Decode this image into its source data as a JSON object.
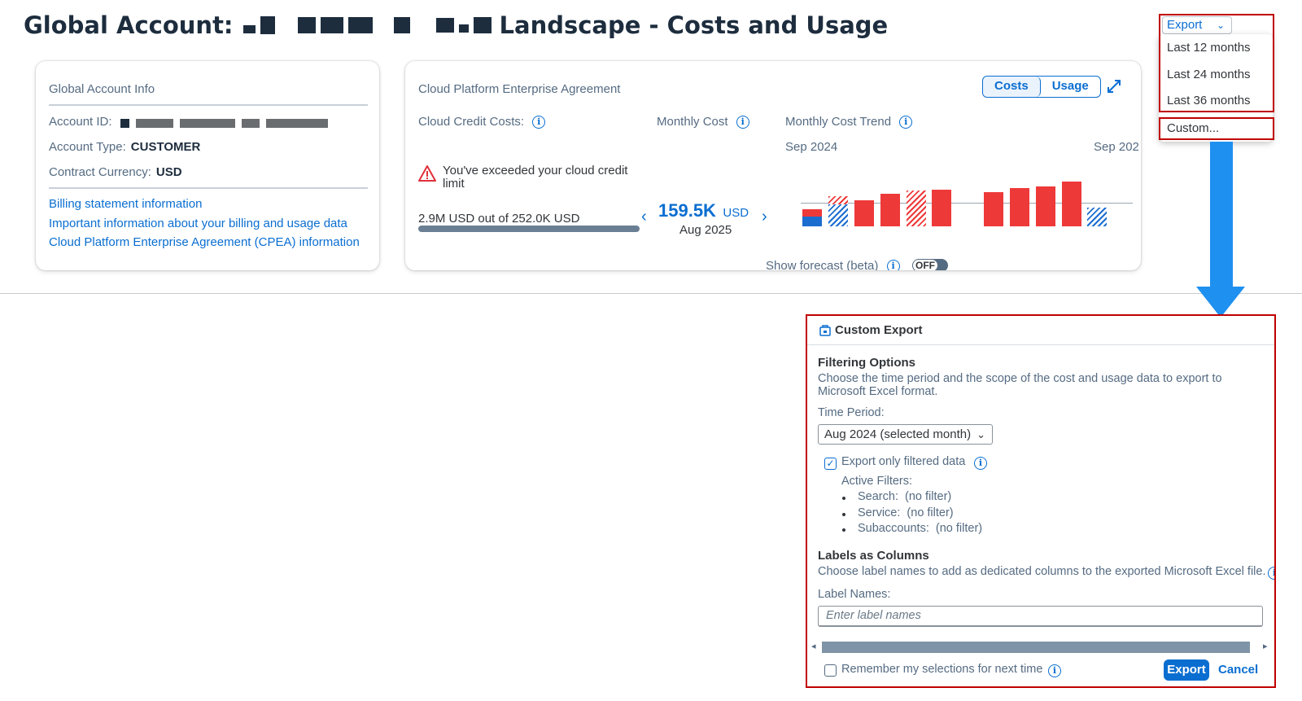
{
  "page": {
    "title_prefix": "Global Account:",
    "title_suffix": "Landscape - Costs and Usage"
  },
  "account_info": {
    "title": "Global Account Info",
    "account_id_label": "Account ID:",
    "account_type_label": "Account Type:",
    "account_type_value": "CUSTOMER",
    "currency_label": "Contract Currency:",
    "currency_value": "USD",
    "links": [
      "Billing statement information",
      "Important information about your billing and usage data",
      "Cloud Platform Enterprise Agreement (CPEA) information"
    ]
  },
  "cpea": {
    "title": "Cloud Platform Enterprise Agreement",
    "tabs": [
      "Costs",
      "Usage"
    ],
    "active_tab": "Costs",
    "credit_costs_label": "Cloud Credit Costs:",
    "monthly_cost_label": "Monthly Cost",
    "monthly_trend_label": "Monthly Cost Trend",
    "warning": "You've exceeded your cloud credit limit",
    "usage_text": "2.9M USD out of 252.0K USD",
    "usage_fraction": 1.0,
    "monthly_value": "159.5K",
    "monthly_currency": "USD",
    "monthly_month": "Aug 2025",
    "trend_start": "Sep 2024",
    "trend_end": "Sep 202",
    "forecast_label": "Show forecast (beta)",
    "forecast_toggle": "OFF",
    "colors": {
      "cost": "#ee3939",
      "credit": "#1c6dd0",
      "accent": "#0a6ed1"
    }
  },
  "export": {
    "button": "Export",
    "menu": [
      "Last 12 months",
      "Last 24 months",
      "Last 36 months",
      "Custom..."
    ]
  },
  "dialog": {
    "title": "Custom Export",
    "filtering_heading": "Filtering Options",
    "filtering_desc_1": "Choose the time period and the scope of the cost and usage data to export to",
    "filtering_desc_2": "Microsoft Excel format.",
    "time_period_label": "Time Period:",
    "time_period_value": "Aug 2024 (selected month)",
    "export_filtered_label": "Export only filtered data",
    "export_filtered_checked": true,
    "active_filters_label": "Active Filters:",
    "filters": [
      {
        "name": "Search:",
        "value": "(no filter)"
      },
      {
        "name": "Service:",
        "value": "(no filter)"
      },
      {
        "name": "Subaccounts:",
        "value": "(no filter)"
      }
    ],
    "labels_heading": "Labels as Columns",
    "labels_desc": "Choose label names to add as dedicated columns to the exported Microsoft Excel file.",
    "label_names_label": "Label Names:",
    "label_names_placeholder": "Enter label names",
    "remember_label": "Remember my selections for next time",
    "remember_checked": false,
    "export_button": "Export",
    "cancel_button": "Cancel"
  }
}
